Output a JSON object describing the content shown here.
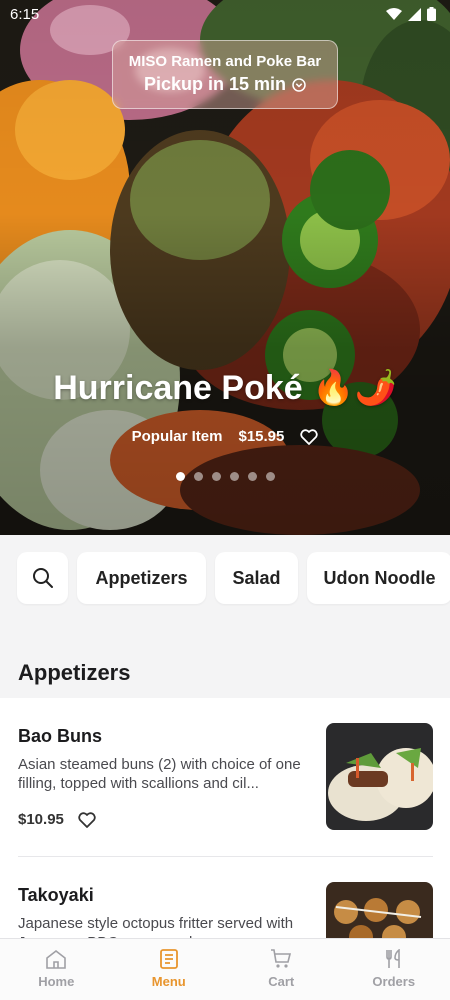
{
  "status_bar": {
    "time": "6:15"
  },
  "store": {
    "name": "MISO Ramen and Poke Bar",
    "pickup": "Pickup in 15 min"
  },
  "featured": {
    "title": "Hurricane Poké 🔥🌶️",
    "tag": "Popular Item",
    "price": "$15.95",
    "carousel_count": 6,
    "carousel_active": 0
  },
  "categories": [
    "Appetizers",
    "Salad",
    "Udon Noodle"
  ],
  "section_title": "Appetizers",
  "items": [
    {
      "title": "Bao Buns",
      "description": "Asian steamed buns (2) with choice of one filling, topped with scallions and cil...",
      "price": "$10.95"
    },
    {
      "title": "Takoyaki",
      "description": "Japanese style octopus fritter served with Japanese BBQ sauce and mayonna..."
    }
  ],
  "nav": [
    {
      "label": "Home",
      "icon": "home-icon"
    },
    {
      "label": "Menu",
      "icon": "menu-icon"
    },
    {
      "label": "Cart",
      "icon": "cart-icon"
    },
    {
      "label": "Orders",
      "icon": "utensils-icon"
    }
  ],
  "colors": {
    "accent": "#e8952e",
    "inactive": "#a0a0a5"
  }
}
